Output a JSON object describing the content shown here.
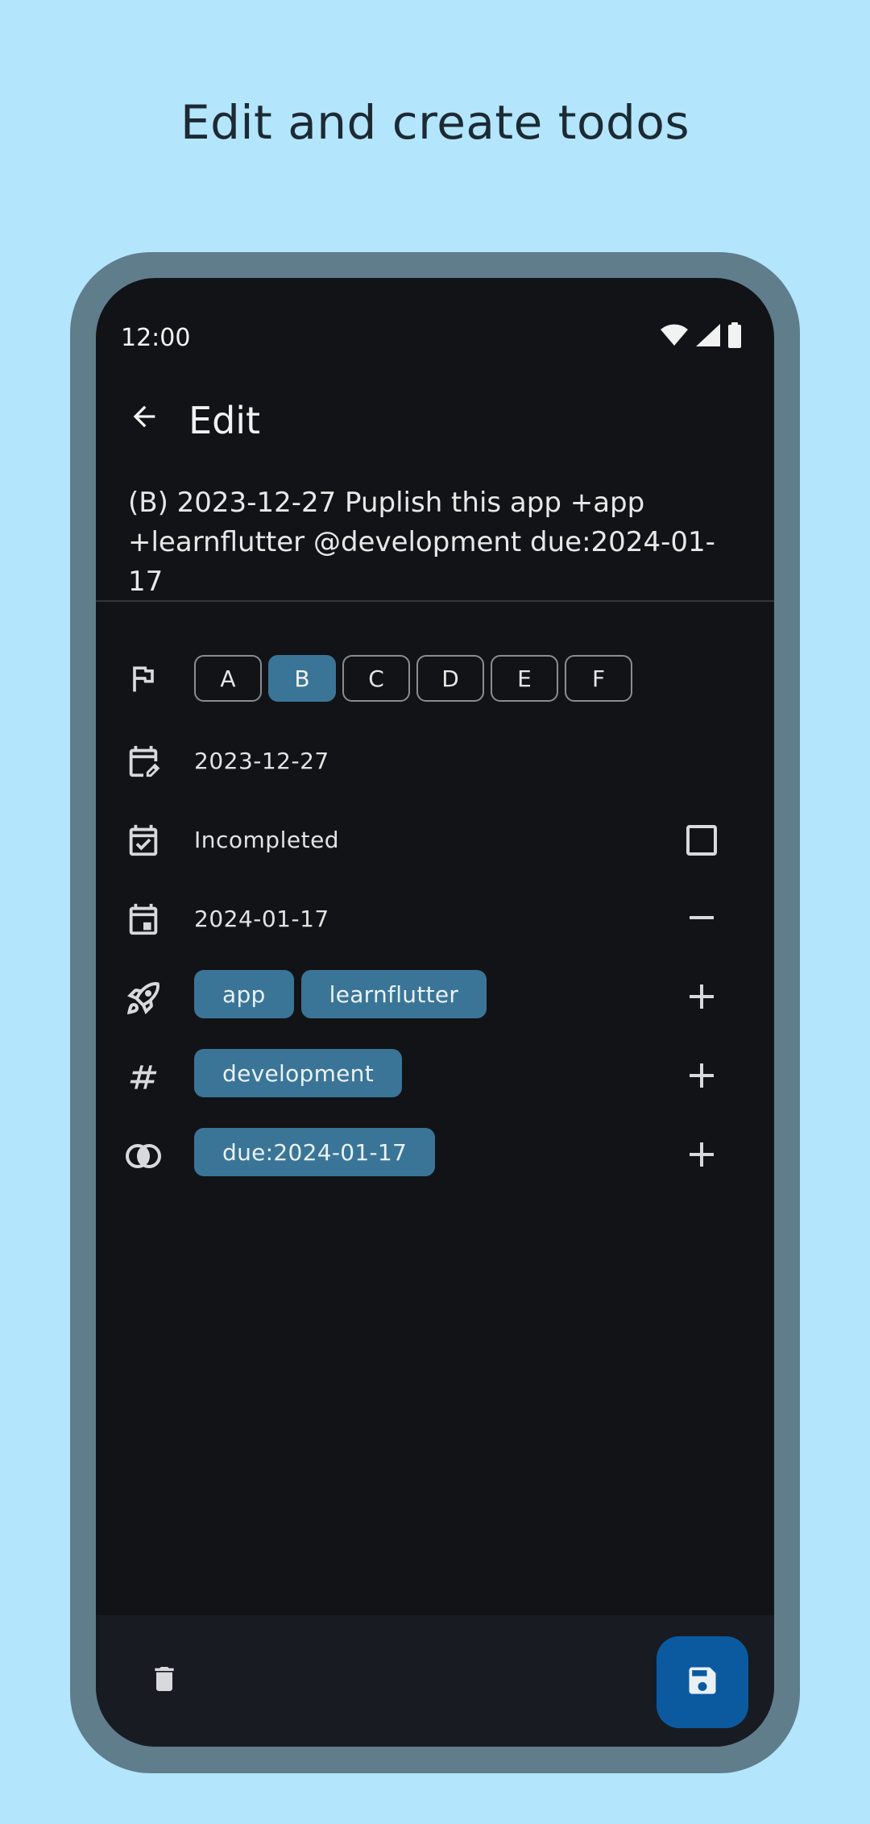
{
  "headline": "Edit and create todos",
  "status_bar": {
    "time": "12:00"
  },
  "app_bar": {
    "title": "Edit"
  },
  "todo": {
    "raw_text": "(B) 2023-12-27 Puplish this app +app +learnflutter @development due:2024-01-17"
  },
  "priority": {
    "options": [
      "A",
      "B",
      "C",
      "D",
      "E",
      "F"
    ],
    "selected": "B"
  },
  "creation_date": "2023-12-27",
  "completion": {
    "status": "Incompleted",
    "checked": false
  },
  "due_date": "2024-01-17",
  "projects": [
    "app",
    "learnflutter"
  ],
  "contexts": [
    "development"
  ],
  "key_values": [
    "due:2024-01-17"
  ],
  "colors": {
    "background": "#b3e5fc",
    "device_frame": "#607d8b",
    "screen": "#121316",
    "chip": "#3a7597",
    "fab": "#0b5aa0"
  },
  "icons": {
    "back": "arrow-back-icon",
    "priority": "flag-icon",
    "creation": "calendar-edit-icon",
    "completion": "calendar-check-icon",
    "due": "calendar-event-icon",
    "projects": "rocket-icon",
    "contexts": "hash-icon",
    "key_values": "intersect-circles-icon",
    "delete": "trash-icon",
    "save": "save-icon"
  }
}
